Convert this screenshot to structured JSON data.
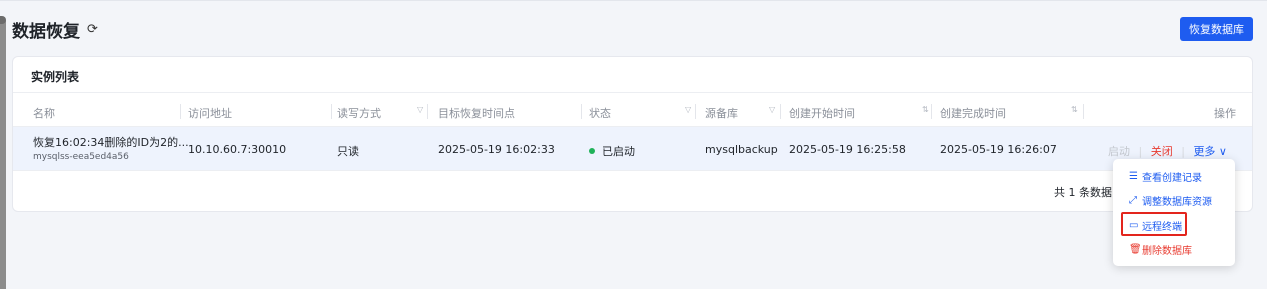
{
  "page": {
    "title": "数据恢复",
    "refresh_icon": "refresh-icon",
    "create_button_label": "恢复数据库"
  },
  "card": {
    "title": "实例列表"
  },
  "table": {
    "columns": [
      {
        "label": "名称"
      },
      {
        "label": "访问地址"
      },
      {
        "label": "读写方式",
        "icon": "filter-icon"
      },
      {
        "label": "目标恢复时间点"
      },
      {
        "label": "状态",
        "icon": "filter-icon"
      },
      {
        "label": "源备库",
        "icon": "filter-icon"
      },
      {
        "label": "创建开始时间",
        "icon": "sort-icon"
      },
      {
        "label": "创建完成时间",
        "icon": "sort-icon"
      },
      {
        "label": "操作"
      }
    ],
    "rows": [
      {
        "name": "恢复16:02:34删除的ID为2的...",
        "instance_id": "mysqlss-eea5ed4a56",
        "address": "10.10.60.7:30010",
        "rw_mode": "只读",
        "target_time": "2025-05-19 16:02:33",
        "status": "已启动",
        "status_color": "#20b259",
        "source": "mysqlbackup",
        "start_time": "2025-05-19 16:25:58",
        "end_time": "2025-05-19 16:26:07",
        "actions": {
          "start": "启动",
          "close": "关闭",
          "more": "更多"
        }
      }
    ],
    "total": "共 1 条数据"
  },
  "dropdown": {
    "items": [
      {
        "label": "查看创建记录",
        "icon": "list-icon"
      },
      {
        "label": "调整数据库资源",
        "icon": "resize-icon"
      },
      {
        "label": "远程终端",
        "icon": "monitor-icon"
      },
      {
        "label": "删除数据库",
        "icon": "trash-icon"
      }
    ]
  },
  "colors": {
    "primary": "#1e5cf0",
    "danger": "#e83a2f",
    "highlight": "#e3251d",
    "selected_row": "#eef3fd"
  }
}
